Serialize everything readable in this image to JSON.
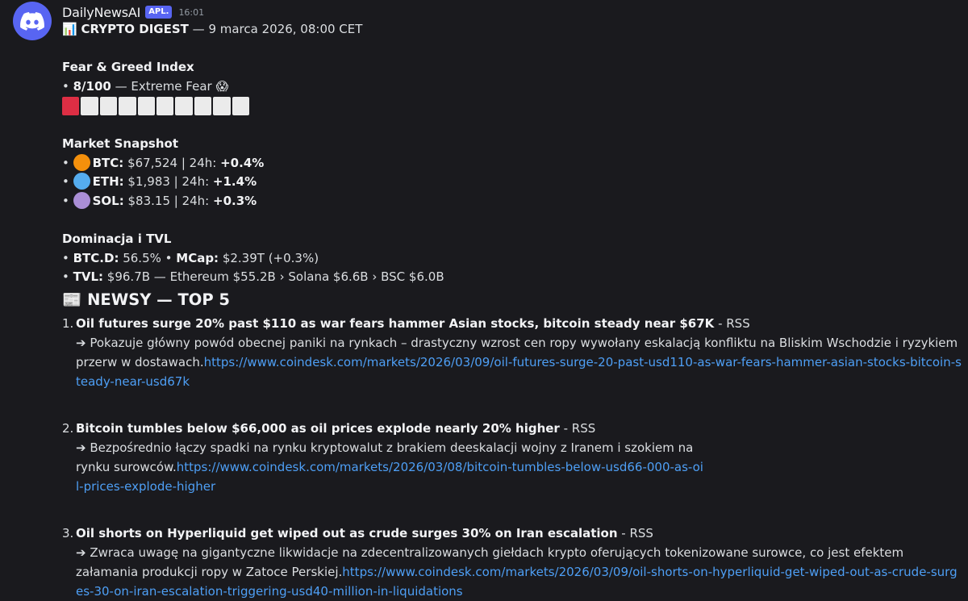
{
  "message": {
    "username": "DailyNewsAI",
    "bot_tag": "APL.",
    "timestamp": "16:01",
    "title_emoji": "📊",
    "title_bold": "CRYPTO DIGEST",
    "title_rest": " — 9 marca 2026, 08:00 CET"
  },
  "fear_greed": {
    "heading": "Fear & Greed Index",
    "bullet": "• ",
    "value": "8/100",
    "label": " — Extreme Fear ",
    "emoji": "😱",
    "level_fraction": 0.08,
    "segments_total": 10,
    "segments_active": 1
  },
  "market": {
    "heading": "Market Snapshot",
    "coins": [
      {
        "symbol": "BTC:",
        "price": " $67,524 | 24h: ",
        "change": "+0.4%",
        "color": "#f4900c"
      },
      {
        "symbol": "ETH:",
        "price": " $1,983 | 24h: ",
        "change": "+1.4%",
        "color": "#55acee"
      },
      {
        "symbol": "SOL:",
        "price": " $83.15 | 24h: ",
        "change": "+0.3%",
        "color": "#aa8ed6"
      }
    ]
  },
  "dominance": {
    "heading": "Dominacja i TVL",
    "btcd_label": "BTC.D:",
    "btcd_value": " 56.5% • ",
    "mcap_label": "MCap:",
    "mcap_value": " $2.39T (+0.3%)",
    "tvl_label": "TVL:",
    "tvl_value": " $96.7B — Ethereum $55.2B › Solana $6.6B › BSC $6.0B"
  },
  "news": {
    "emoji": "📰",
    "heading": "NEWSY — TOP 5",
    "items": [
      {
        "num": "1.",
        "title": "Oil futures surge 20% past $110 as war fears hammer Asian stocks, bitcoin steady near $67K",
        "source": " - RSS",
        "desc": "➔ Pokazuje główny powód obecnej paniki na rynkach – drastyczny wzrost cen ropy wywołany eskalacją konfliktu na Bliskim Wschodzie i ryzykiem przerw w dostawach.",
        "url": "https://www.coindesk.com/markets/2026/03/09/oil-futures-surge-20-past-usd110-as-war-fears-hammer-asian-stocks-bitcoin-steady-near-usd67k"
      },
      {
        "num": "2.",
        "title": "Bitcoin tumbles below $66,000 as oil prices explode nearly 20% higher",
        "source": " - RSS",
        "desc": "➔ Bezpośrednio łączy spadki na rynku kryptowalut z brakiem deeskalacji wojny z Iranem i szokiem na rynku surowców.",
        "url": "https://www.coindesk.com/markets/2026/03/08/bitcoin-tumbles-below-usd66-000-as-oil-prices-explode-higher"
      },
      {
        "num": "3.",
        "title": "Oil shorts on Hyperliquid get wiped out as crude surges 30% on Iran escalation",
        "source": " - RSS",
        "desc": "➔ Zwraca uwagę na gigantyczne likwidacje na zdecentralizowanych giełdach krypto oferujących tokenizowane surowce, co jest efektem załamania produkcji ropy w Zatoce Perskiej.",
        "url": "https://www.coindesk.com/markets/2026/03/09/oil-shorts-on-hyperliquid-get-wiped-out-as-crude-surges-30-on-iran-escalation-triggering-usd40-million-in-liquidations"
      }
    ]
  },
  "icons": {
    "avatar": "discord-logo-icon",
    "colors": {
      "avatar_bg": "#5865f2",
      "bot_tag_bg": "#5865f2",
      "link": "#4e9ff5",
      "fg_active": "#dd2e44",
      "fg_inactive": "#ebebeb"
    }
  }
}
